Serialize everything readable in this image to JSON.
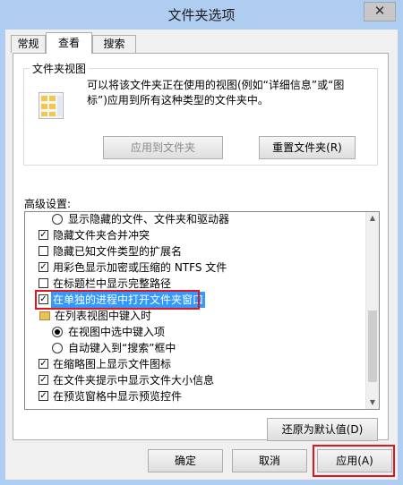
{
  "window": {
    "title": "文件夹选项",
    "close_label": "✕"
  },
  "tabs": [
    {
      "label": "常规"
    },
    {
      "label": "查看"
    },
    {
      "label": "搜索"
    }
  ],
  "folder_views": {
    "group_label": "文件夹视图",
    "description": "可以将该文件夹正在使用的视图(例如“详细信息”或“图标”)应用到所有这种类型的文件夹中。",
    "apply_label": "应用到文件夹",
    "reset_label": "重置文件夹(R)"
  },
  "advanced": {
    "label": "高级设置:",
    "items": [
      {
        "label": "显示隐藏的文件、文件夹和驱动器"
      },
      {
        "label": "隐藏文件夹合并冲突"
      },
      {
        "label": "隐藏已知文件类型的扩展名"
      },
      {
        "label": "用彩色显示加密或压缩的 NTFS 文件"
      },
      {
        "label": "在标题栏中显示完整路径"
      },
      {
        "label": "在单独的进程中打开文件夹窗口"
      },
      {
        "label": "在列表视图中键入时"
      },
      {
        "label": "在视图中选中键入项"
      },
      {
        "label": "自动键入到“搜索”框中"
      },
      {
        "label": "在缩略图上显示文件图标"
      },
      {
        "label": "在文件夹提示中显示文件大小信息"
      },
      {
        "label": "在预览窗格中显示预览控件"
      }
    ],
    "restore_label": "还原为默认值(D)"
  },
  "footer": {
    "ok_label": "确定",
    "cancel_label": "取消",
    "apply_label": "应用(A)"
  }
}
